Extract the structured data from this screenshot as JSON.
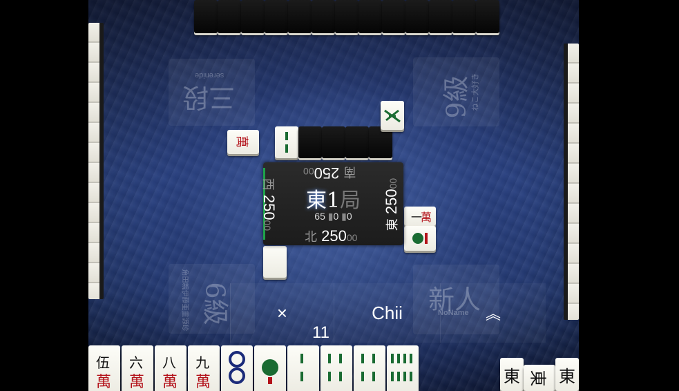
{
  "players": {
    "top": {
      "rank": "三段",
      "name": "serenide"
    },
    "right": {
      "rank": "9級",
      "name": "ねこ大好き"
    },
    "left": {
      "rank": "6級",
      "name": "角田親伊藤亜重源珍"
    },
    "self": {
      "rank": "新人",
      "name": "NoName"
    }
  },
  "center": {
    "round_wind": "東",
    "round_number": "1",
    "round_kyoku": "局",
    "remaining_tiles": "65",
    "honba": "0",
    "riichi_sticks": "0",
    "scores": {
      "self": {
        "wind": "北",
        "value": "250",
        "suffix": "00"
      },
      "right": {
        "wind": "東",
        "value": "250",
        "suffix": "00"
      },
      "top": {
        "wind": "南",
        "value": "250",
        "suffix": "00"
      },
      "left": {
        "wind": "西",
        "value": "250",
        "suffix": "00"
      }
    }
  },
  "actions": {
    "skip_label": "×",
    "chii_label": "Chii",
    "expand_label": "⌃⌃"
  },
  "timer": "11",
  "hand": [
    {
      "id": "5m-red",
      "top": "伍",
      "suit": "萬"
    },
    {
      "id": "6m",
      "top": "六",
      "suit": "萬"
    },
    {
      "id": "8m",
      "top": "八",
      "suit": "萬"
    },
    {
      "id": "9m",
      "top": "九",
      "suit": "萬"
    },
    {
      "id": "2p",
      "pattern": "circles2"
    },
    {
      "id": "1s",
      "pattern": "bird"
    },
    {
      "id": "2s",
      "pattern": "bamboo2"
    },
    {
      "id": "4s",
      "pattern": "bamboo4"
    },
    {
      "id": "4s-b",
      "pattern": "bamboo4"
    },
    {
      "id": "8s",
      "pattern": "bamboo8"
    }
  ],
  "self_melds": [
    {
      "id": "east",
      "label": "東"
    },
    {
      "id": "east-sideways",
      "label": "東"
    },
    {
      "id": "east-2",
      "label": "東"
    }
  ],
  "colors": {
    "red": "#b3121a",
    "green": "#1a6b32",
    "blue": "#1b2b7a",
    "dark": "#111111"
  }
}
